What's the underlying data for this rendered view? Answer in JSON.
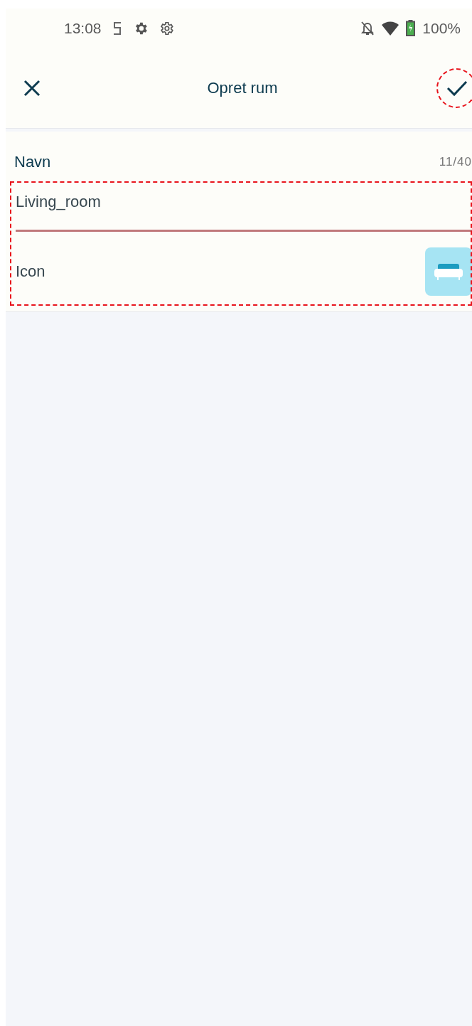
{
  "status_bar": {
    "time": "13:08",
    "battery": "100%"
  },
  "header": {
    "title": "Opret rum",
    "confirm_highlighted": true
  },
  "form": {
    "highlighted": true,
    "name_label": "Navn",
    "counter": "11/40",
    "name_value": "Living_room",
    "icon_label": "Icon"
  }
}
